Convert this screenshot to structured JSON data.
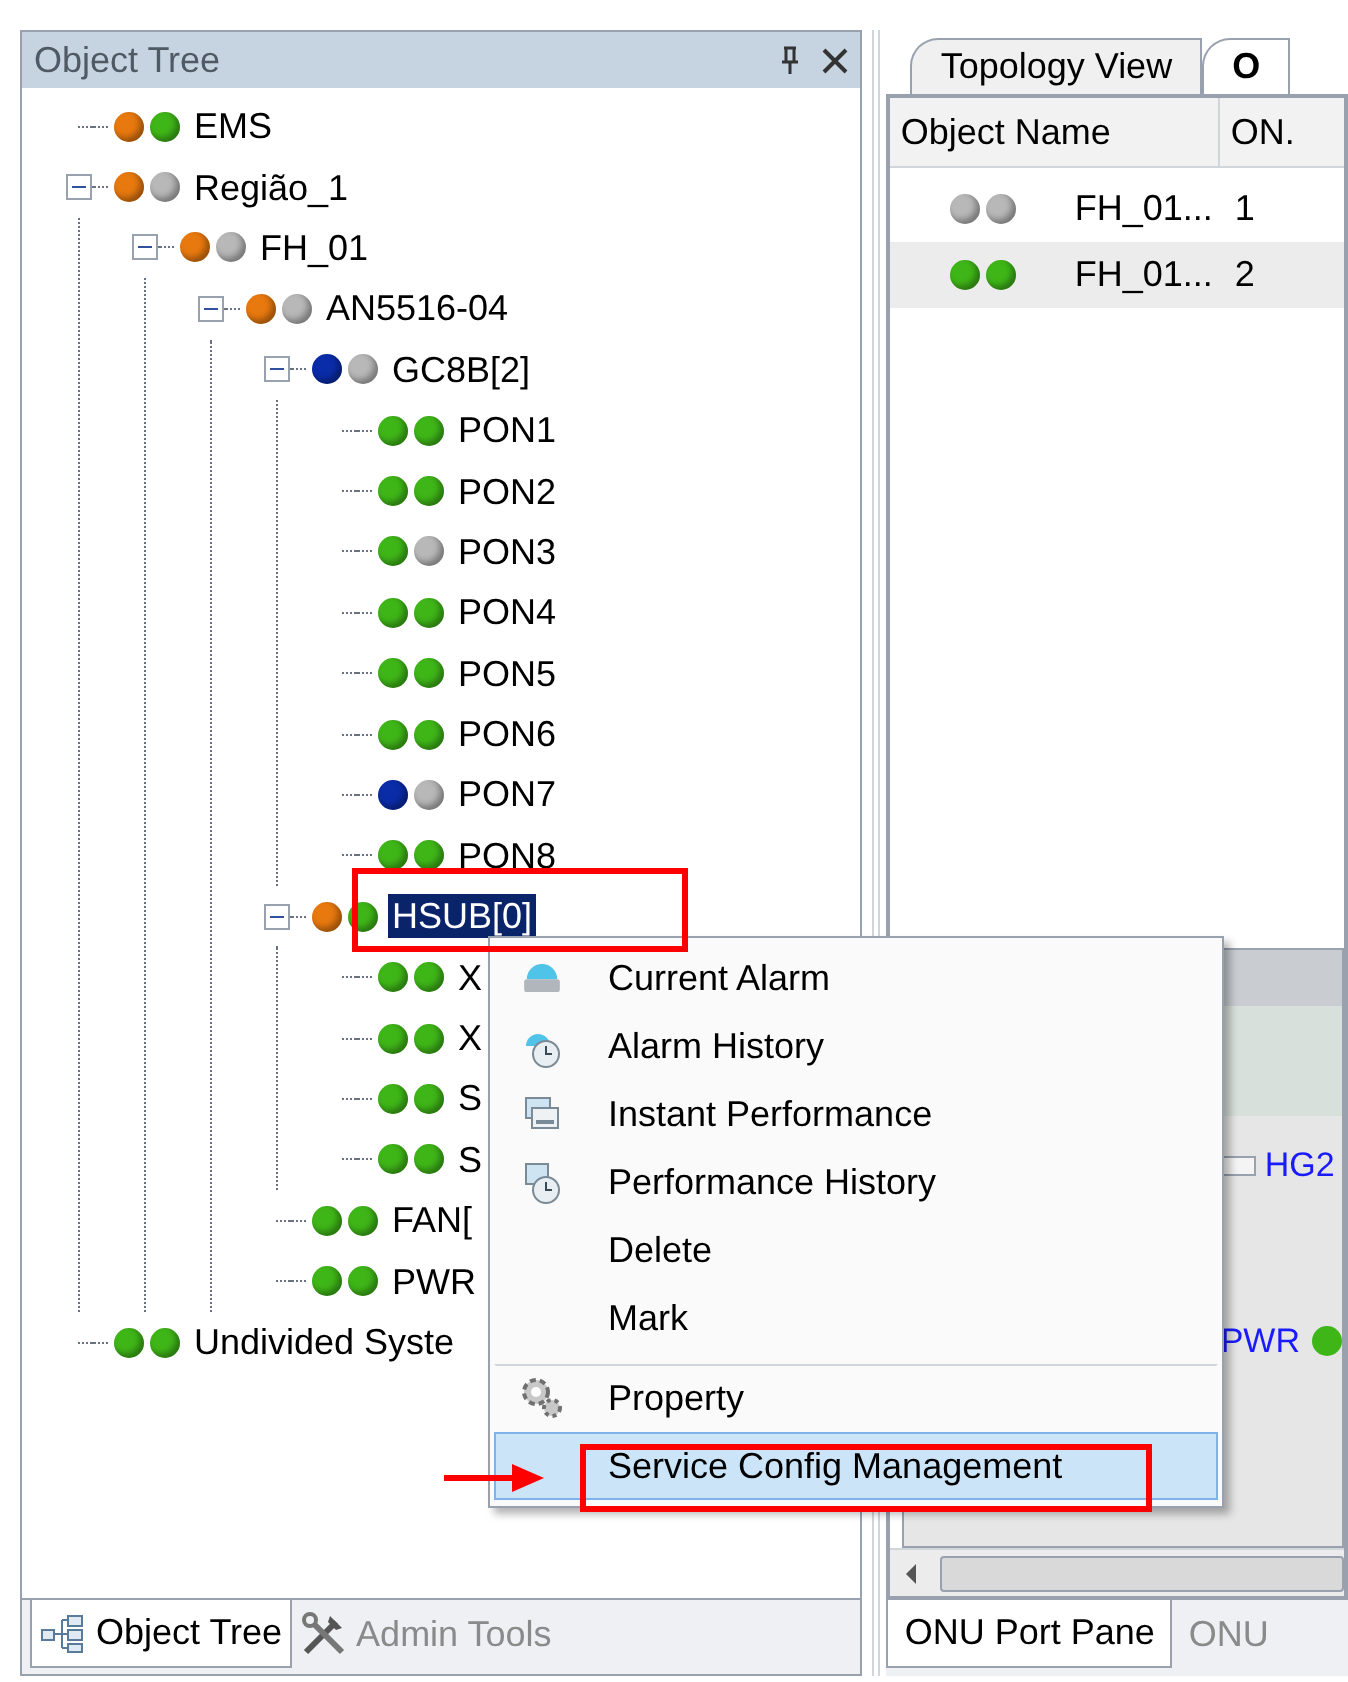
{
  "left_panel": {
    "title": "Object Tree"
  },
  "tree": [
    {
      "label": "EMS",
      "selected": false,
      "status": [
        {
          "color": "#e8790f"
        },
        {
          "color": "#3fb618"
        }
      ]
    },
    {
      "label": "Região_1",
      "selected": false,
      "expanded": true,
      "status": [
        {
          "color": "#e8790f"
        },
        {
          "color": "#b8b8b8"
        }
      ],
      "children": [
        {
          "label": "FH_01",
          "selected": false,
          "expanded": true,
          "status": [
            {
              "color": "#e8790f"
            },
            {
              "color": "#b8b8b8"
            }
          ],
          "children": [
            {
              "label": "AN5516-04",
              "selected": false,
              "expanded": true,
              "status": [
                {
                  "color": "#e8790f"
                },
                {
                  "color": "#b8b8b8"
                }
              ],
              "children": [
                {
                  "label": "GC8B[2]",
                  "selected": false,
                  "expanded": true,
                  "status": [
                    {
                      "color": "#0a2ca8"
                    },
                    {
                      "color": "#b8b8b8"
                    }
                  ],
                  "children": [
                    {
                      "label": "PON1",
                      "selected": false,
                      "status": [
                        {
                          "color": "#3fb618"
                        },
                        {
                          "color": "#3fb618"
                        }
                      ]
                    },
                    {
                      "label": "PON2",
                      "selected": false,
                      "status": [
                        {
                          "color": "#3fb618"
                        },
                        {
                          "color": "#3fb618"
                        }
                      ]
                    },
                    {
                      "label": "PON3",
                      "selected": false,
                      "status": [
                        {
                          "color": "#3fb618"
                        },
                        {
                          "color": "#b8b8b8"
                        }
                      ]
                    },
                    {
                      "label": "PON4",
                      "selected": false,
                      "status": [
                        {
                          "color": "#3fb618"
                        },
                        {
                          "color": "#3fb618"
                        }
                      ]
                    },
                    {
                      "label": "PON5",
                      "selected": false,
                      "status": [
                        {
                          "color": "#3fb618"
                        },
                        {
                          "color": "#3fb618"
                        }
                      ]
                    },
                    {
                      "label": "PON6",
                      "selected": false,
                      "status": [
                        {
                          "color": "#3fb618"
                        },
                        {
                          "color": "#3fb618"
                        }
                      ]
                    },
                    {
                      "label": "PON7",
                      "selected": false,
                      "status": [
                        {
                          "color": "#0a2ca8"
                        },
                        {
                          "color": "#b8b8b8"
                        }
                      ]
                    },
                    {
                      "label": "PON8",
                      "selected": false,
                      "status": [
                        {
                          "color": "#3fb618"
                        },
                        {
                          "color": "#3fb618"
                        }
                      ]
                    }
                  ]
                },
                {
                  "label": "HSUB[0]",
                  "selected": true,
                  "expanded": true,
                  "status": [
                    {
                      "color": "#e8790f"
                    },
                    {
                      "color": "#3fb618"
                    }
                  ],
                  "children": [
                    {
                      "label": "X",
                      "selected": false,
                      "status": [
                        {
                          "color": "#3fb618"
                        },
                        {
                          "color": "#3fb618"
                        }
                      ]
                    },
                    {
                      "label": "X",
                      "selected": false,
                      "status": [
                        {
                          "color": "#3fb618"
                        },
                        {
                          "color": "#3fb618"
                        }
                      ]
                    },
                    {
                      "label": "S",
                      "selected": false,
                      "status": [
                        {
                          "color": "#3fb618"
                        },
                        {
                          "color": "#3fb618"
                        }
                      ]
                    },
                    {
                      "label": "S",
                      "selected": false,
                      "status": [
                        {
                          "color": "#3fb618"
                        },
                        {
                          "color": "#3fb618"
                        }
                      ]
                    }
                  ]
                },
                {
                  "label": "FAN[",
                  "selected": false,
                  "status": [
                    {
                      "color": "#3fb618"
                    },
                    {
                      "color": "#3fb618"
                    }
                  ]
                },
                {
                  "label": "PWR",
                  "selected": false,
                  "status": [
                    {
                      "color": "#3fb618"
                    },
                    {
                      "color": "#3fb618"
                    }
                  ]
                }
              ]
            }
          ]
        }
      ]
    },
    {
      "label": "Undivided Syste",
      "selected": false,
      "status": [
        {
          "color": "#3fb618"
        },
        {
          "color": "#3fb618"
        }
      ]
    }
  ],
  "left_tabs": [
    {
      "label": "Object Tree",
      "selected": true
    },
    {
      "label": "Admin Tools",
      "selected": false
    }
  ],
  "right_panel": {
    "tabs": [
      {
        "label": "Topology View",
        "selected": false
      },
      {
        "label": "O",
        "selected": true
      }
    ],
    "table": {
      "columns": [
        "Object Name",
        "ON."
      ],
      "rows": [
        {
          "status": [
            {
              "color": "#b8b8b8"
            },
            {
              "color": "#b8b8b8"
            }
          ],
          "name": "FH_01...",
          "column_2": "1",
          "selected": false
        },
        {
          "status": [
            {
              "color": "#3fb618"
            },
            {
              "color": "#3fb618"
            }
          ],
          "name": "FH_01...",
          "column_2": "2",
          "selected": true
        }
      ]
    },
    "device_labels": [
      "HG2",
      "PWR"
    ],
    "bottom_tabs": [
      {
        "label": "ONU Port Pane",
        "selected": true
      },
      {
        "label": "ONU",
        "selected": false
      }
    ]
  },
  "context_menu": [
    {
      "label": "Current Alarm",
      "separator_before": false,
      "selected": false
    },
    {
      "label": "Alarm History",
      "separator_before": false,
      "selected": false
    },
    {
      "label": "Instant Performance",
      "separator_before": false,
      "selected": false
    },
    {
      "label": "Performance History",
      "separator_before": false,
      "selected": false
    },
    {
      "label": "Delete",
      "separator_before": false,
      "selected": false
    },
    {
      "label": "Mark",
      "separator_before": false,
      "selected": false
    },
    {
      "label": "Property",
      "separator_before": true,
      "selected": false
    },
    {
      "label": "Service Config Management",
      "separator_before": false,
      "selected": true
    }
  ]
}
